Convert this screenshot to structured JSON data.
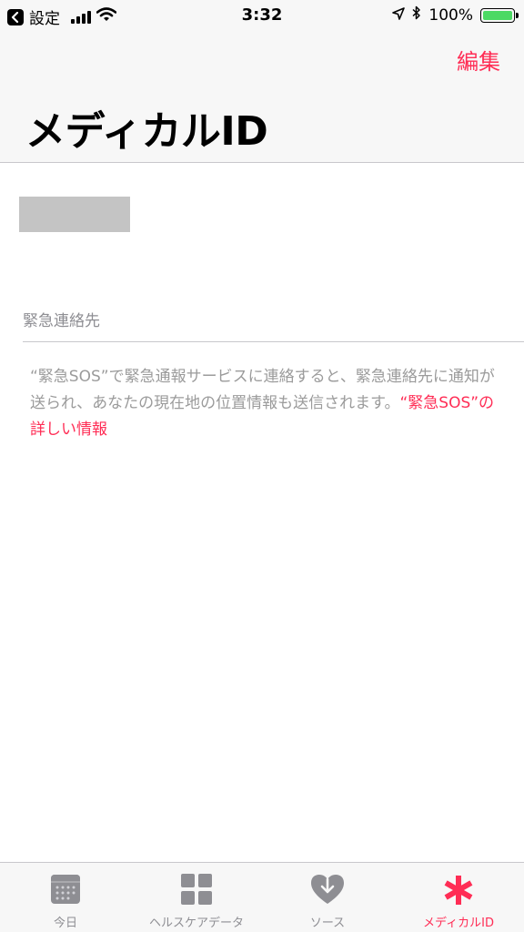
{
  "status_bar": {
    "back_app": "設定",
    "time": "3:32",
    "battery_percent": "100%",
    "battery_level": 1.0,
    "icons": [
      "back-icon",
      "cellular-signal-icon",
      "wifi-icon",
      "location-arrow-icon",
      "bluetooth-icon",
      "battery-icon"
    ]
  },
  "nav": {
    "edit_label": "編集",
    "title": "メディカルID"
  },
  "content": {
    "section_header": "緊急連絡先",
    "footnote_text": "“緊急SOS”で緊急通報サービスに連絡すると、緊急連絡先に通知が送られ、あなたの現在地の位置情報も送信されます。",
    "footnote_link": "“緊急SOS”の詳しい情報"
  },
  "tabs": [
    {
      "label": "今日",
      "icon": "calendar-icon",
      "active": false
    },
    {
      "label": "ヘルスケアデータ",
      "icon": "grid-icon",
      "active": false
    },
    {
      "label": "ソース",
      "icon": "heart-download-icon",
      "active": false
    },
    {
      "label": "メディカルID",
      "icon": "asterisk-icon",
      "active": true
    }
  ],
  "colors": {
    "accent": "#ff2d55",
    "battery_green": "#4cd964",
    "inactive_icon": "#8e8e93"
  }
}
